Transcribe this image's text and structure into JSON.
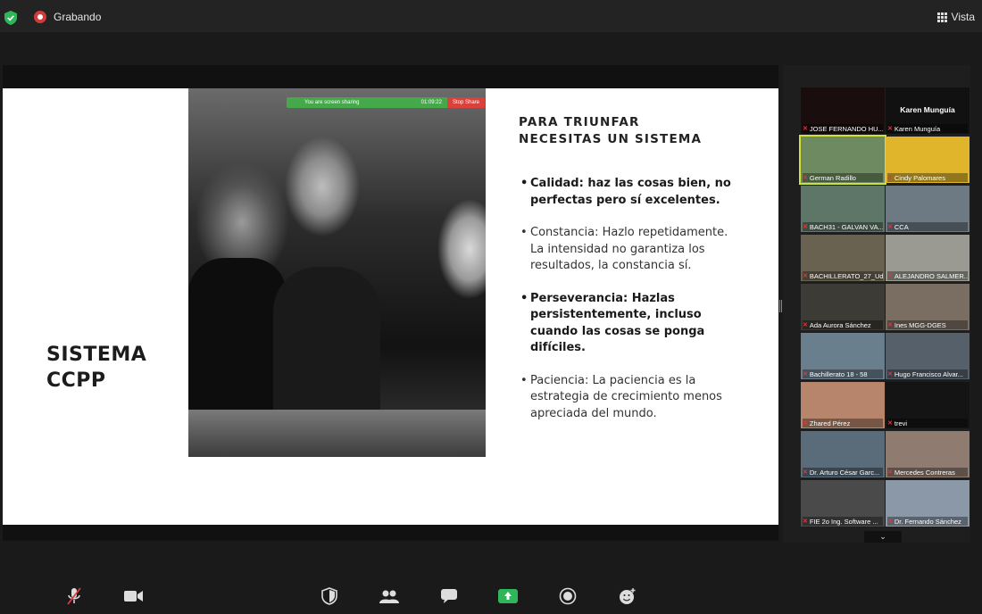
{
  "topbar": {
    "recording_label": "Grabando",
    "view_label": "Vista"
  },
  "share_bar": {
    "status": "You are screen sharing",
    "timer": "01:09:22",
    "stop_label": "Stop Share"
  },
  "slide": {
    "left_title_line1": "SISTEMA",
    "left_title_line2": "CCPP",
    "heading_line1": "PARA TRIUNFAR",
    "heading_line2": "NECESITAS UN SISTEMA",
    "bullets": [
      "Calidad: haz las cosas bien, no perfectas pero sí excelentes.",
      "Constancia: Hazlo repetidamente. La intensidad no garantiza los resultados, la constancia sí.",
      "Perseverancia: Hazlas persistentemente, incluso cuando las cosas se ponga difíciles.",
      "Paciencia: La paciencia es la estrategia de crecimiento menos apreciada del mundo."
    ]
  },
  "participants": [
    {
      "name": "JOSE FERNANDO HU...",
      "bg": "#1a0d0d"
    },
    {
      "name": "Karen Munguía",
      "center": "Karen Munguía",
      "bg": "#111111"
    },
    {
      "name": "German Radillo",
      "bg": "#6e8a60",
      "active": true
    },
    {
      "name": "Cindy Palomares",
      "bg": "#e1b52b"
    },
    {
      "name": "BACH31 - GALVAN VA...",
      "bg": "#5e7668"
    },
    {
      "name": "CCA",
      "bg": "#6d7a84"
    },
    {
      "name": "BACHILLERATO_27_Ud...",
      "bg": "#6a6250"
    },
    {
      "name": "ALEJANDRO SALMER...",
      "bg": "#9a9a92"
    },
    {
      "name": "Ada Aurora Sánchez",
      "bg": "#3d3b36"
    },
    {
      "name": "Ines MGG-DGES",
      "bg": "#7a6e63"
    },
    {
      "name": "Bachillerato 18 - 58",
      "bg": "#6a7f8e"
    },
    {
      "name": "Hugo Francisco Alvar...",
      "bg": "#55606a"
    },
    {
      "name": "Zhared Pérez",
      "bg": "#b6856b"
    },
    {
      "name": "trevi",
      "bg": "#141414"
    },
    {
      "name": "Dr. Arturo César Garc...",
      "bg": "#5a6c7a"
    },
    {
      "name": "Mercedes Contreras",
      "bg": "#8f7b70"
    },
    {
      "name": "FIE 2o Ing. Software ...",
      "bg": "#4a4a4a"
    },
    {
      "name": "Dr. Fernando Sánchez",
      "bg": "#8a98a8"
    }
  ],
  "colors": {
    "accent_green": "#45a94b",
    "stop_red": "#d9413a",
    "active_speaker": "#cfe23a",
    "muted_red": "#e0383e"
  },
  "toolbar_icons": [
    "mic-muted-icon",
    "video-icon",
    "security-icon",
    "participants-icon",
    "chat-icon",
    "share-screen-icon",
    "record-icon",
    "reactions-icon"
  ]
}
